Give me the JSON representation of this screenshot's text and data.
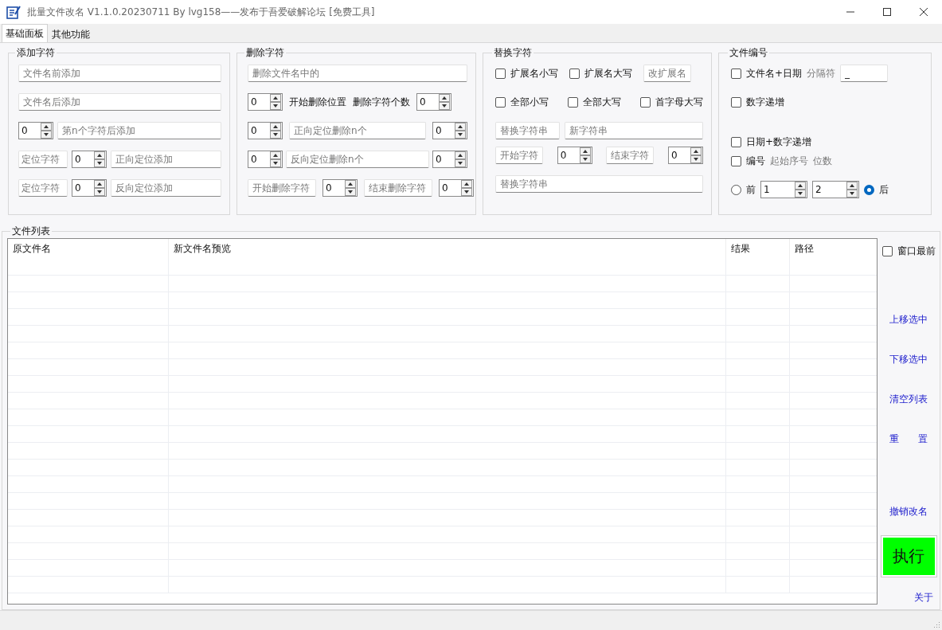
{
  "window": {
    "title": "批量文件改名  V1.1.0.20230711  By lvg158——发布于吾爱破解论坛 [免费工具]"
  },
  "tabs": [
    {
      "label": "基础面板",
      "selected": true
    },
    {
      "label": "其他功能",
      "selected": false
    }
  ],
  "groups": [
    {
      "title": "添加字符",
      "rows": [
        {
          "controls": [
            {
              "kind": "field",
              "placeholder": "文件名前添加"
            }
          ]
        },
        {
          "controls": [
            {
              "kind": "field",
              "placeholder": "文件名后添加"
            }
          ]
        },
        {
          "controls": [
            {
              "kind": "spinner",
              "value": "0"
            },
            {
              "kind": "field",
              "placeholder": "第n个字符后添加"
            }
          ]
        },
        {
          "controls": [
            {
              "kind": "tag",
              "placeholder": "定位字符"
            },
            {
              "kind": "spinner",
              "value": "0"
            },
            {
              "kind": "field",
              "placeholder": "正向定位添加"
            }
          ]
        },
        {
          "controls": [
            {
              "kind": "tag",
              "placeholder": "定位字符"
            },
            {
              "kind": "spinner",
              "value": "0"
            },
            {
              "kind": "field",
              "placeholder": "反向定位添加"
            }
          ]
        }
      ]
    },
    {
      "title": "删除字符",
      "rows": [
        {
          "controls": [
            {
              "kind": "field",
              "placeholder": "删除文件名中的"
            }
          ]
        },
        {
          "controls": [
            {
              "kind": "spinner",
              "value": "0"
            },
            {
              "kind": "label",
              "text": "开始删除位置",
              "disabled": false
            },
            {
              "kind": "label",
              "text": "删除字符个数",
              "disabled": false
            },
            {
              "kind": "spinner",
              "value": "0"
            }
          ]
        },
        {
          "controls": [
            {
              "kind": "spinner",
              "value": "0"
            },
            {
              "kind": "field",
              "placeholder": "正向定位删除n个"
            },
            {
              "kind": "spinner",
              "value": "0"
            }
          ]
        },
        {
          "controls": [
            {
              "kind": "spinner",
              "value": "0"
            },
            {
              "kind": "field",
              "placeholder": "反向定位删除n个"
            },
            {
              "kind": "spinner",
              "value": "0"
            }
          ]
        },
        {
          "controls": [
            {
              "kind": "tag",
              "placeholder": "开始删除字符"
            },
            {
              "kind": "spinner",
              "value": "0"
            },
            {
              "kind": "tag",
              "placeholder": "结束删除字符"
            },
            {
              "kind": "spinner",
              "value": "0"
            }
          ]
        }
      ]
    },
    {
      "title": "替换字符",
      "rows": [
        {
          "controls": [
            {
              "kind": "checkbox",
              "label": "扩展名小写",
              "checked": false
            },
            {
              "kind": "checkbox",
              "label": "扩展名大写",
              "checked": false
            },
            {
              "kind": "tag",
              "placeholder": "改扩展名"
            }
          ]
        },
        {
          "controls": [
            {
              "kind": "checkbox",
              "label": "全部小写",
              "checked": false
            },
            {
              "kind": "checkbox",
              "label": "全部大写",
              "checked": false
            },
            {
              "kind": "checkbox",
              "label": "首字母大写",
              "checked": false
            }
          ]
        },
        {
          "controls": [
            {
              "kind": "tag",
              "placeholder": "替换字符串"
            },
            {
              "kind": "field",
              "placeholder": "新字符串"
            }
          ]
        },
        {
          "controls": [
            {
              "kind": "tag",
              "placeholder": "开始字符"
            },
            {
              "kind": "spinner",
              "value": "0"
            },
            {
              "kind": "tag",
              "placeholder": "结束字符"
            },
            {
              "kind": "spinner",
              "value": "0"
            }
          ]
        },
        {
          "controls": [
            {
              "kind": "field",
              "placeholder": "替换字符串"
            }
          ]
        }
      ]
    },
    {
      "title": "文件编号",
      "rows": [
        {
          "controls": [
            {
              "kind": "checkbox",
              "label": "文件名+日期",
              "checked": false
            },
            {
              "kind": "label",
              "text": "分隔符",
              "disabled": true
            },
            {
              "kind": "tag",
              "value": "_"
            }
          ]
        },
        {
          "controls": [
            {
              "kind": "checkbox",
              "label": "数字递增",
              "checked": false
            }
          ]
        },
        {
          "controls": [
            {
              "kind": "checkbox",
              "label": "日期+数字递增",
              "checked": false
            }
          ]
        },
        {
          "controls": [
            {
              "kind": "checkbox",
              "label": "编号",
              "checked": false
            },
            {
              "kind": "label",
              "text": "起始序号",
              "disabled": true
            },
            {
              "kind": "label",
              "text": "位数",
              "disabled": true
            }
          ]
        },
        {
          "controls": [
            {
              "kind": "radio",
              "label": "前",
              "selected": false
            },
            {
              "kind": "spinner",
              "value": "1"
            },
            {
              "kind": "spinner",
              "value": "2"
            },
            {
              "kind": "radio",
              "label": "后",
              "selected": true
            }
          ]
        }
      ]
    }
  ],
  "file_list": {
    "title": "文件列表",
    "columns": [
      "原文件名",
      "新文件名预览",
      "结果",
      "路径"
    ]
  },
  "side": {
    "topmost": {
      "label": "窗口最前",
      "checked": false
    },
    "links": [
      "上移选中",
      "下移选中",
      "清空列表",
      "重　　置",
      "撤销改名"
    ],
    "run_button": "执行",
    "about": "关于"
  }
}
